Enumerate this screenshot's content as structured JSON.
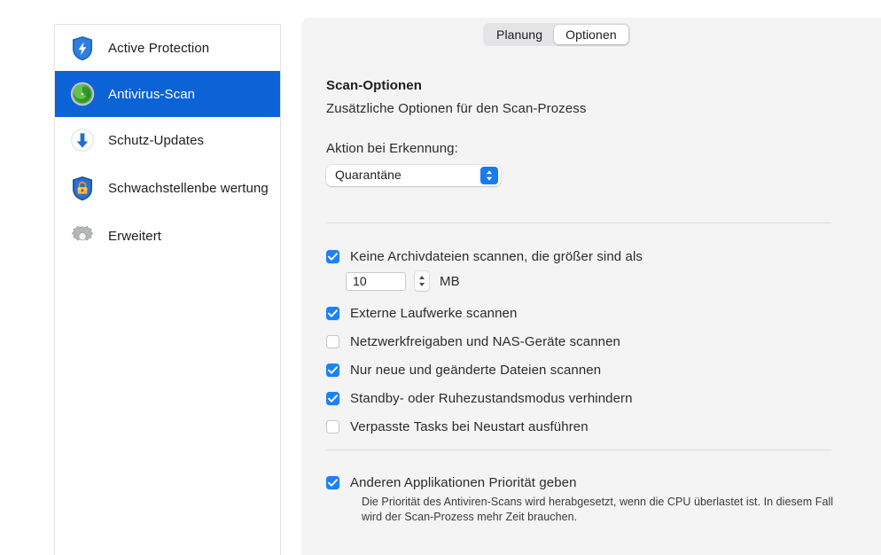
{
  "sidebar": {
    "items": [
      {
        "label": "Active Protection",
        "icon": "shield-bolt-icon",
        "selected": false
      },
      {
        "label": "Antivirus-Scan",
        "icon": "radar-circle-icon",
        "selected": true
      },
      {
        "label": "Schutz-Updates",
        "icon": "download-arrow-icon",
        "selected": false
      },
      {
        "label": "Schwachstellenbe wertung",
        "icon": "shield-lock-icon",
        "selected": false
      },
      {
        "label": "Erweitert",
        "icon": "gear-icon",
        "selected": false
      }
    ]
  },
  "tabs": {
    "items": [
      {
        "label": "Planung",
        "active": false
      },
      {
        "label": "Optionen",
        "active": true
      }
    ]
  },
  "main": {
    "title": "Scan-Optionen",
    "subtitle": "Zusätzliche Optionen für den Scan-Prozess",
    "action_label": "Aktion bei Erkennung:",
    "action_value": "Quarantäne",
    "archive_size_value": "10",
    "archive_size_unit": "MB",
    "checkboxes": [
      {
        "label": "Keine Archivdateien scannen, die größer sind als",
        "checked": true
      },
      {
        "label": "Externe Laufwerke scannen",
        "checked": true
      },
      {
        "label": "Netzwerkfreigaben und NAS-Geräte scannen",
        "checked": false
      },
      {
        "label": "Nur neue und geänderte Dateien scannen",
        "checked": true
      },
      {
        "label": "Standby- oder Ruhezustandsmodus verhindern",
        "checked": true
      },
      {
        "label": "Verpasste Tasks bei Neustart ausführen",
        "checked": false
      }
    ],
    "priority": {
      "label": "Anderen Applikationen Priorität geben",
      "checked": true,
      "description": "Die Priorität des Antiviren-Scans wird herabgesetzt, wenn die CPU überlastet ist. In diesem Fall wird der Scan-Prozess mehr Zeit brauchen."
    }
  },
  "colors": {
    "accent": "#0b63d6",
    "checkbox_on": "#1a82f7",
    "panel_bg": "#f4f4f4"
  }
}
